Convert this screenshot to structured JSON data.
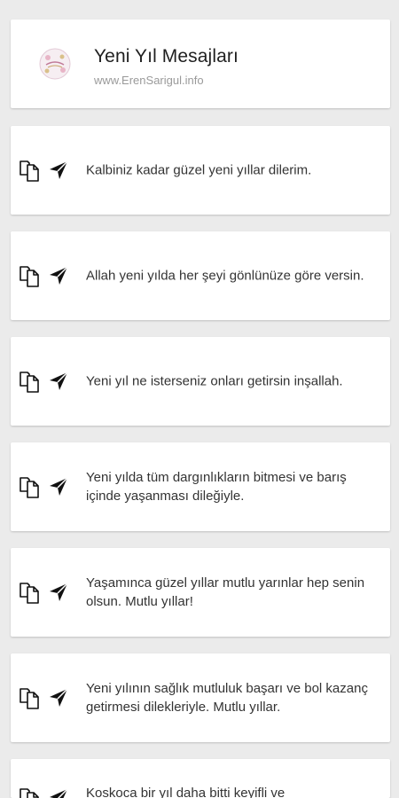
{
  "header": {
    "title": "Yeni Yıl Mesajları",
    "subtitle": "www.ErenSarigul.info"
  },
  "colors": {
    "background": "#ebebeb",
    "card": "#ffffff",
    "text": "#333333",
    "subtitle": "#9a9a9a"
  },
  "icons": {
    "copy": "copy-icon",
    "send": "send-icon"
  },
  "messages": [
    "Kalbiniz kadar güzel yeni yıllar dilerim.",
    "Allah yeni yılda her şeyi gönlünüze göre versin.",
    "Yeni yıl ne isterseniz onları getirsin inşallah.",
    "Yeni yılda tüm dargınlıkların bitmesi ve barış içinde yaşanması dileğiyle.",
    "Yaşamınca güzel yıllar mutlu yarınlar hep senin olsun. Mutlu yıllar!",
    "Yeni yılının sağlık mutluluk başarı ve bol kazanç getirmesi dilekleriyle. Mutlu yıllar.",
    "Koskoca bir yıl daha bitti keyifli ve"
  ]
}
